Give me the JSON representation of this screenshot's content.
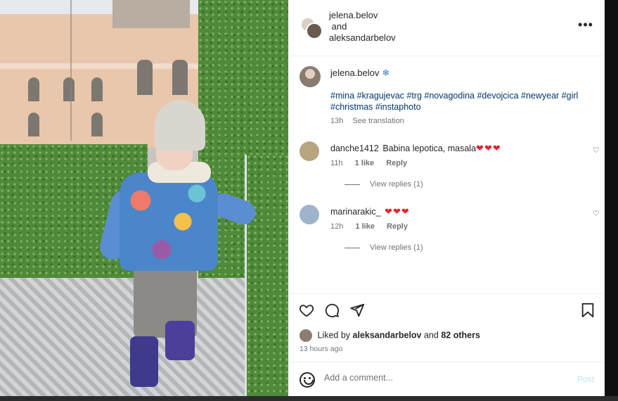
{
  "header": {
    "user1": "jelena.belov",
    "joiner": "and",
    "user2": "aleksandarbelov"
  },
  "caption": {
    "username": "jelena.belov",
    "emoji": "❄",
    "hashtags": "#mina #kragujevac #trg #novagodina #devojcica #newyear #girl #christmas #instaphoto",
    "time": "13h",
    "see_translation": "See translation"
  },
  "comments": [
    {
      "username": "danche1412",
      "text": "Babina lepotica, masala",
      "hearts": "❤❤❤",
      "time": "11h",
      "likes": "1 like",
      "reply": "Reply",
      "view_replies": "View replies (1)"
    },
    {
      "username": "marinarakic_",
      "text": "",
      "hearts": "❤❤❤",
      "time": "12h",
      "likes": "1 like",
      "reply": "Reply",
      "view_replies": "View replies (1)"
    }
  ],
  "actions": {
    "icons": [
      "heart-icon",
      "comment-icon",
      "share-icon",
      "bookmark-icon"
    ]
  },
  "likes": {
    "prefix": "Liked by",
    "user": "aleksandarbelov",
    "joiner": "and",
    "others": "82 others"
  },
  "post_time": "13 hours ago",
  "add_comment": {
    "placeholder": "Add a comment...",
    "post_label": "Post"
  },
  "colors": {
    "hashtag": "#00376b",
    "heart": "#e0262e",
    "post_disabled": "#c0dffd",
    "muted": "#737373"
  }
}
